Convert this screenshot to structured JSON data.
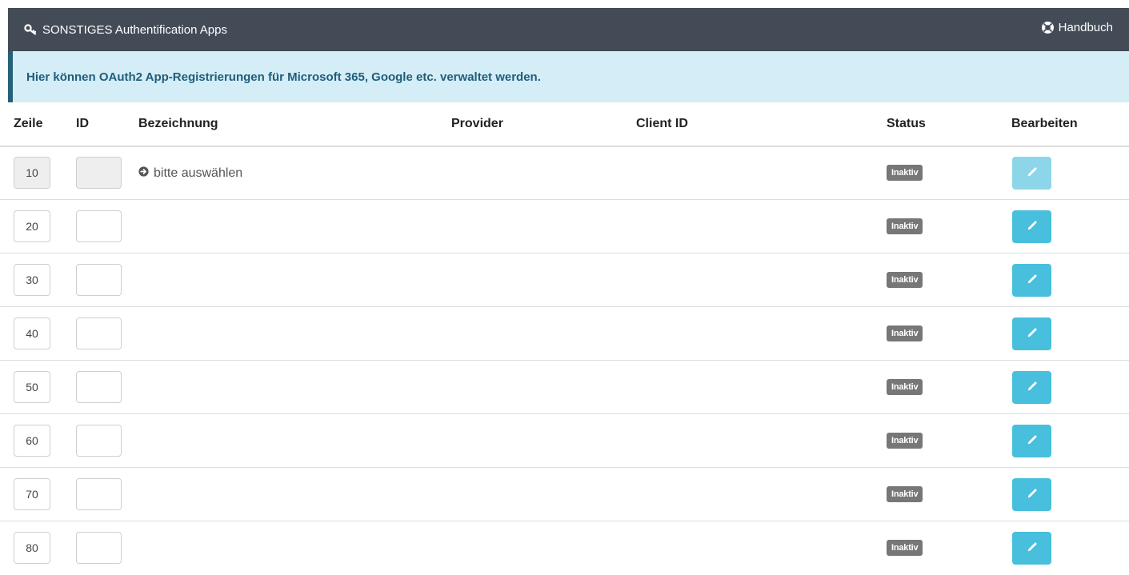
{
  "header": {
    "title": "SONSTIGES Authentification Apps",
    "title_icon": "key-icon",
    "manual_label": "Handbuch",
    "manual_icon": "lifebuoy-icon",
    "background": "#434b57"
  },
  "info": {
    "text": "Hier können OAuth2 App-Registrierungen für Microsoft 365, Google etc. verwaltet werden.",
    "background": "#d4edf7",
    "color": "#1f5e7a"
  },
  "table": {
    "columns": {
      "zeile": "Zeile",
      "id": "ID",
      "bezeichnung": "Bezeichnung",
      "provider": "Provider",
      "client_id": "Client ID",
      "status": "Status",
      "bearbeiten": "Bearbeiten"
    },
    "rows": [
      {
        "zeile": "10",
        "id": "",
        "bezeichnung": "bitte auswählen",
        "provider": "",
        "client_id": "",
        "status": "Inaktiv"
      },
      {
        "zeile": "20",
        "id": "",
        "bezeichnung": "",
        "provider": "",
        "client_id": "",
        "status": "Inaktiv"
      },
      {
        "zeile": "30",
        "id": "",
        "bezeichnung": "",
        "provider": "",
        "client_id": "",
        "status": "Inaktiv"
      },
      {
        "zeile": "40",
        "id": "",
        "bezeichnung": "",
        "provider": "",
        "client_id": "",
        "status": "Inaktiv"
      },
      {
        "zeile": "50",
        "id": "",
        "bezeichnung": "",
        "provider": "",
        "client_id": "",
        "status": "Inaktiv"
      },
      {
        "zeile": "60",
        "id": "",
        "bezeichnung": "",
        "provider": "",
        "client_id": "",
        "status": "Inaktiv"
      },
      {
        "zeile": "70",
        "id": "",
        "bezeichnung": "",
        "provider": "",
        "client_id": "",
        "status": "Inaktiv"
      },
      {
        "zeile": "80",
        "id": "",
        "bezeichnung": "",
        "provider": "",
        "client_id": "",
        "status": "Inaktiv"
      }
    ],
    "status_color": "#777777",
    "edit_button_color": "#47bfdd",
    "edit_icon": "pencil-icon",
    "select_icon": "arrow-circle-right-icon"
  }
}
